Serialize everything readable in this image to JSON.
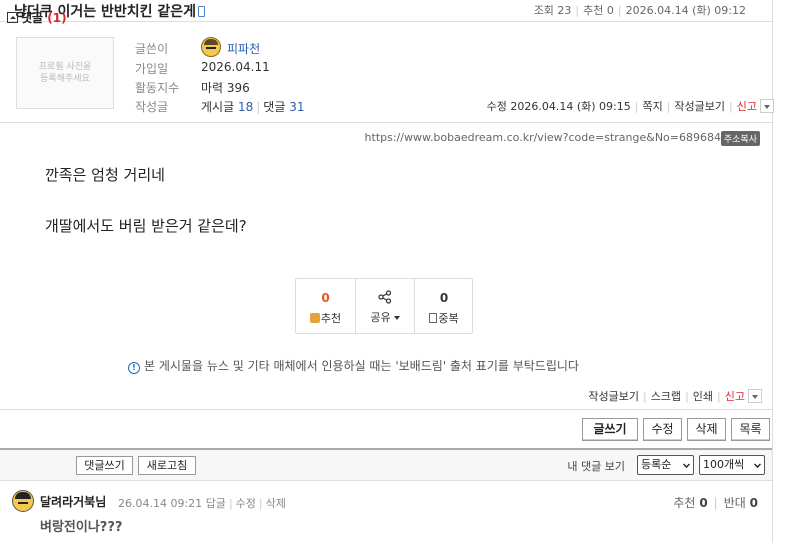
{
  "post": {
    "title": "냥더쿠 이거는 반반치킨 같은게",
    "mobile_icon": "mobile-phone-icon",
    "views": "조회 23",
    "recommends": "추천 0",
    "datetime": "2026.04.14 (화) 09:12"
  },
  "author": {
    "photo_placeholder_line1": "프로필 사진을",
    "photo_placeholder_line2": "등록해주세요",
    "labels": {
      "writer": "글쓴이",
      "joined": "가입일",
      "activity": "활동지수",
      "posts": "작성글"
    },
    "nickname": "피파천",
    "joined": "2026.04.11",
    "activity": "마력 396",
    "posts_label": "게시글",
    "posts_count": "18",
    "comments_label": "댓글",
    "comments_count": "31"
  },
  "actions": {
    "edited": "수정 2026.04.14 (화) 09:15",
    "note": "쪽지",
    "view_posts": "작성글보기",
    "report": "신고"
  },
  "url": {
    "text": "https://www.bobaedream.co.kr/view?code=strange&No=6896840",
    "copy_label": "주소복사"
  },
  "content": {
    "line1": "깐족은 엄청 거리네",
    "line2": "개딸에서도 버림 받은거 같은데?"
  },
  "vote_box": {
    "recommend_count": "0",
    "recommend_label": "추천",
    "share_label": "공유",
    "duplicate_count": "0",
    "duplicate_label": "중복"
  },
  "notice": "본 게시물을 뉴스 및 기타 매체에서 인용하실 때는 '보배드림' 출처 표기를 부탁드립니다",
  "bottom_actions": {
    "view_posts": "작성글보기",
    "scrap": "스크랩",
    "print": "인쇄",
    "report": "신고"
  },
  "buttons": {
    "list": "글쓰기",
    "edit": "수정",
    "delete": "삭제",
    "catalog": "목록"
  },
  "comments": {
    "title": "댓글",
    "count": "(1)",
    "write": "댓글쓰기",
    "refresh": "새로고침",
    "my_comments": "내 댓글 보기",
    "sort": "등록순",
    "per_page": "100개씩",
    "items": [
      {
        "nick": "달려라거북님",
        "datetime": "26.04.14 09:21",
        "reply": "답글",
        "edit": "수정",
        "delete": "삭제",
        "up_label": "추천",
        "up": "0",
        "down_label": "반대",
        "down": "0",
        "text": "벼랑전이나???"
      }
    ]
  },
  "colors": {
    "link_blue": "#2a5fb0",
    "accent_orange": "#e05a1c",
    "report_red": "#d23"
  }
}
